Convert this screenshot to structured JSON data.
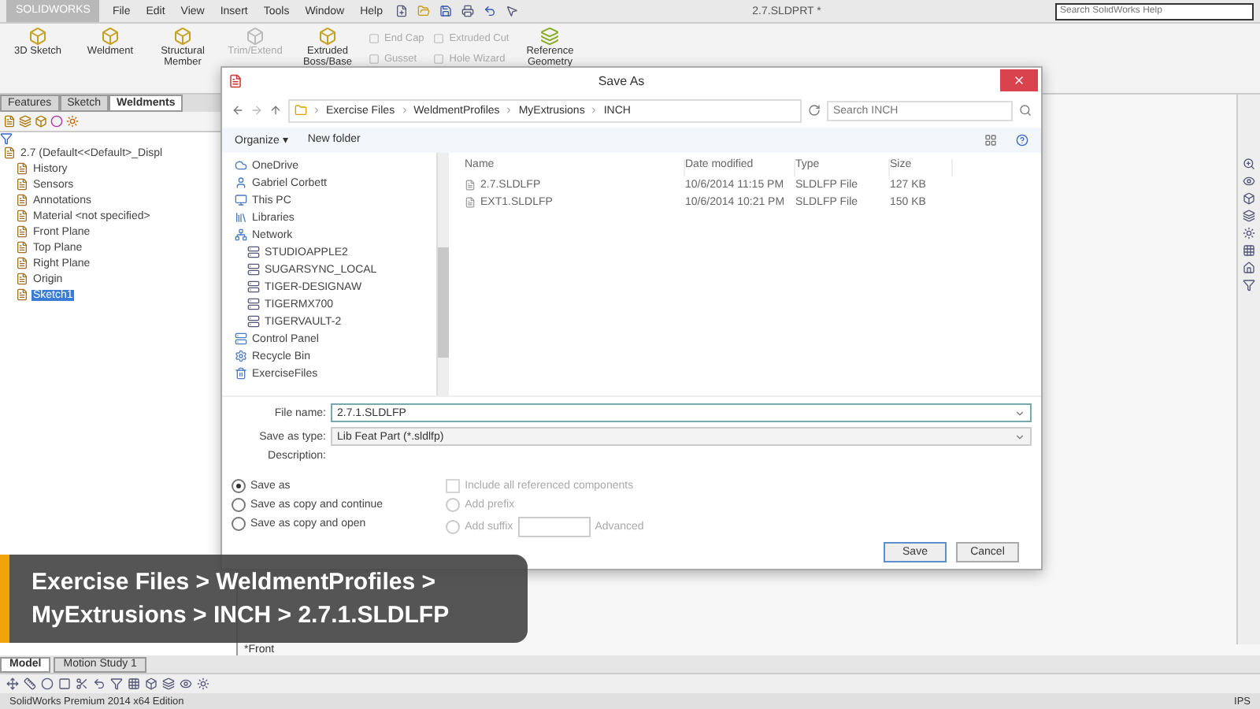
{
  "app": {
    "logo": "SOLIDWORKS",
    "menus": [
      "File",
      "Edit",
      "View",
      "Insert",
      "Tools",
      "Window",
      "Help"
    ],
    "document_title": "2.7.SLDPRT *",
    "help_search": {
      "placeholder": "Search SolidWorks Help"
    }
  },
  "ribbon": {
    "large": [
      {
        "label": "3D Sketch",
        "disabled": false
      },
      {
        "label": "Weldment",
        "disabled": false
      },
      {
        "label": "Structural Member",
        "disabled": false
      },
      {
        "label": "Trim/Extend",
        "disabled": true
      },
      {
        "label": "Extruded Boss/Base",
        "disabled": false
      }
    ],
    "small": [
      {
        "label": "End Cap",
        "disabled": true
      },
      {
        "label": "Gusset",
        "disabled": true
      },
      {
        "label": "Extruded Cut",
        "disabled": true
      },
      {
        "label": "Hole Wizard",
        "disabled": true
      }
    ],
    "reference": {
      "label": "Reference Geometry",
      "disabled": false
    }
  },
  "feature_manager": {
    "tabs": [
      {
        "label": "Features",
        "selected": false
      },
      {
        "label": "Sketch",
        "selected": false
      },
      {
        "label": "Weldments",
        "selected": true
      }
    ],
    "tree": [
      {
        "label": "2.7  (Default<<Default>_Displ",
        "selected": false,
        "children": [
          {
            "label": "History",
            "selected": false
          },
          {
            "label": "Sensors",
            "selected": false
          },
          {
            "label": "Annotations",
            "selected": false
          },
          {
            "label": "Material <not specified>",
            "selected": false
          },
          {
            "label": "Front Plane",
            "selected": false
          },
          {
            "label": "Top Plane",
            "selected": false
          },
          {
            "label": "Right Plane",
            "selected": false
          },
          {
            "label": "Origin",
            "selected": false
          },
          {
            "label": "Sketch1",
            "selected": true
          }
        ]
      }
    ]
  },
  "dialog": {
    "title": "Save As",
    "path": [
      "Exercise Files",
      "WeldmentProfiles",
      "MyExtrusions",
      "INCH"
    ],
    "search": {
      "placeholder": "Search INCH"
    },
    "toolbar": [
      "Organize ▾",
      "New folder"
    ],
    "nav": [
      {
        "label": "OneDrive"
      },
      {
        "label": "Gabriel Corbett"
      },
      {
        "label": "This PC"
      },
      {
        "label": "Libraries"
      },
      {
        "label": "Network",
        "children": [
          {
            "label": "STUDIOAPPLE2"
          },
          {
            "label": "SUGARSYNC_LOCAL"
          },
          {
            "label": "TIGER-DESIGNAW"
          },
          {
            "label": "TIGERMX700"
          },
          {
            "label": "TIGERVAULT-2"
          }
        ]
      },
      {
        "label": "Control Panel"
      },
      {
        "label": "Recycle Bin"
      },
      {
        "label": "ExerciseFiles"
      }
    ],
    "columns": [
      "Name",
      "Date modified",
      "Type",
      "Size"
    ],
    "files": [
      {
        "name": "2.7.SLDLFP",
        "date": "10/6/2014 11:15 PM",
        "type": "SLDLFP File",
        "size": "127 KB"
      },
      {
        "name": "EXT1.SLDLFP",
        "date": "10/6/2014 10:21 PM",
        "type": "SLDLFP File",
        "size": "150 KB"
      }
    ],
    "file_name": {
      "label": "File name:",
      "value": "2.7.1.SLDLFP"
    },
    "save_type": {
      "label": "Save as type:",
      "value": "Lib Feat Part (*.sldlfp)"
    },
    "description_label": "Description:",
    "save_modes": [
      {
        "label": "Save as",
        "selected": true
      },
      {
        "label": "Save as copy and continue",
        "selected": false
      },
      {
        "label": "Save as copy and open",
        "selected": false
      }
    ],
    "include_refs": {
      "label": "Include all referenced components",
      "checked": false,
      "disabled": true
    },
    "affixes": [
      {
        "label": "Add prefix",
        "selected": false,
        "disabled": true
      },
      {
        "label": "Add suffix",
        "selected": false,
        "disabled": true
      }
    ],
    "advanced": "Advanced",
    "buttons": [
      "Save",
      "Cancel"
    ]
  },
  "view_label": "*Front",
  "bottom_tabs": [
    {
      "label": "Model",
      "selected": true
    },
    {
      "label": "Motion Study 1",
      "selected": false
    }
  ],
  "status_bar": {
    "edition": "SolidWorks Premium 2014 x64 Edition",
    "units": "IPS"
  },
  "caption": {
    "lines": [
      "Exercise Files > WeldmentProfiles >",
      "MyExtrusions > INCH > 2.7.1.SLDLFP"
    ]
  }
}
